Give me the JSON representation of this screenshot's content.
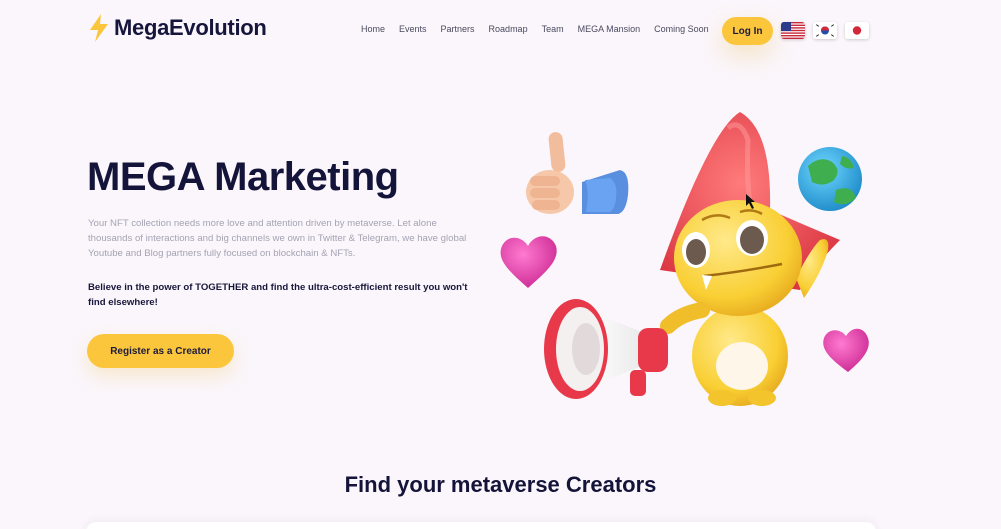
{
  "brand": {
    "name": "MegaEvolution",
    "accent": "#fcc63c",
    "text_color": "#14143a"
  },
  "nav": {
    "items": [
      "Home",
      "Events",
      "Partners",
      "Roadmap",
      "Team",
      "MEGA Mansion",
      "Coming Soon"
    ],
    "login_label": "Log In",
    "languages": [
      {
        "icon": "us-flag-icon"
      },
      {
        "icon": "kr-flag-icon"
      },
      {
        "icon": "jp-flag-icon"
      }
    ]
  },
  "hero": {
    "title": "MEGA Marketing",
    "description": "Your NFT collection needs more love and attention driven by metaverse. Let alone thousands of interactions and big channels we own in Twitter & Telegram, we have global Youtube and Blog partners fully focused on blockchain & NFTs.",
    "highlight": "Believe in the power of TOGETHER and find the ultra-cost-efficient result you won't find elsewhere!",
    "cta_label": "Register as a Creator"
  },
  "illustration": {
    "items": [
      "thumbs-up-icon",
      "globe-icon",
      "heart-icon",
      "megaphone-icon",
      "yellow-mascot-character",
      "cursor-icon"
    ]
  },
  "section": {
    "title": "Find your metaverse Creators"
  }
}
